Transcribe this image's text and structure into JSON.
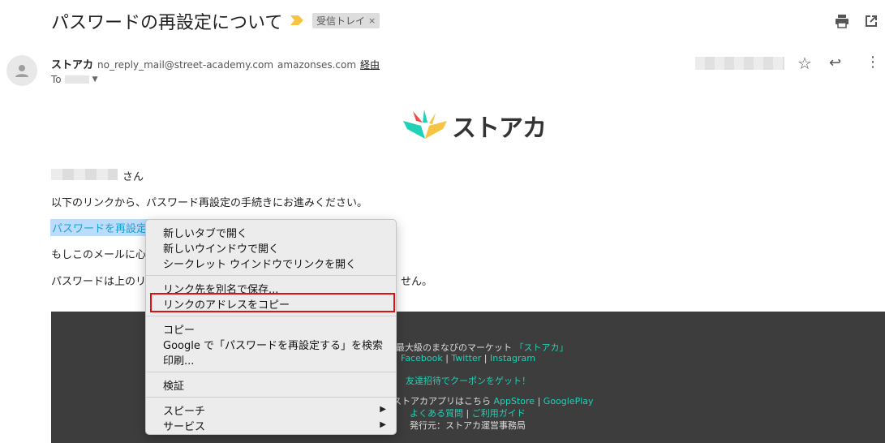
{
  "email": {
    "subject": "パスワードの再設定について",
    "label": "受信トレイ",
    "label_close": "×",
    "sender_name": "ストアカ",
    "sender_email": "no_reply_mail@street-academy.com",
    "sender_domain": "amazonses.com",
    "via": "経由",
    "to_prefix": "To",
    "greeting_suffix": "さん",
    "line1": "以下のリンクから、パスワード再設定の手続きにお進みください。",
    "link_text": "パスワードを再設定",
    "line3_start": "もしこのメールに心",
    "line4_start": "パスワードは上のリ",
    "line4_end": "せん。",
    "logo_text": "ストアカ"
  },
  "footer": {
    "line1_text": "最大級のまなびのマーケット",
    "line1_brand": "「ストアカ」",
    "facebook": "Facebook",
    "twitter": "Twitter",
    "instagram": "Instagram",
    "sep": "|",
    "invite": "友達招待でクーポンをゲット！",
    "app_text": "ストアカアプリはこちら",
    "appstore": "AppStore",
    "googleplay": "GooglePlay",
    "faq": "よくある質問",
    "guide": "ご利用ガイド",
    "publisher": "発行元：ストアカ運営事務局"
  },
  "context_menu": {
    "items": [
      "新しいタブで開く",
      "新しいウインドウで開く",
      "シークレット ウインドウでリンクを開く",
      "リンク先を別名で保存...",
      "リンクのアドレスをコピー",
      "コピー",
      "Google で「パスワードを再設定する」を検索",
      "印刷...",
      "検証",
      "スピーチ",
      "サービス"
    ],
    "submenu_arrow": "▶"
  },
  "icons": {
    "print": "print-icon",
    "open_new": "open-in-new-icon",
    "star": "☆",
    "reply": "↩",
    "more": "⋮",
    "chevron": "▼"
  },
  "colors": {
    "teal": "#1dd2b6",
    "highlight": "#e01010",
    "footer_bg": "#3d3d3d"
  }
}
